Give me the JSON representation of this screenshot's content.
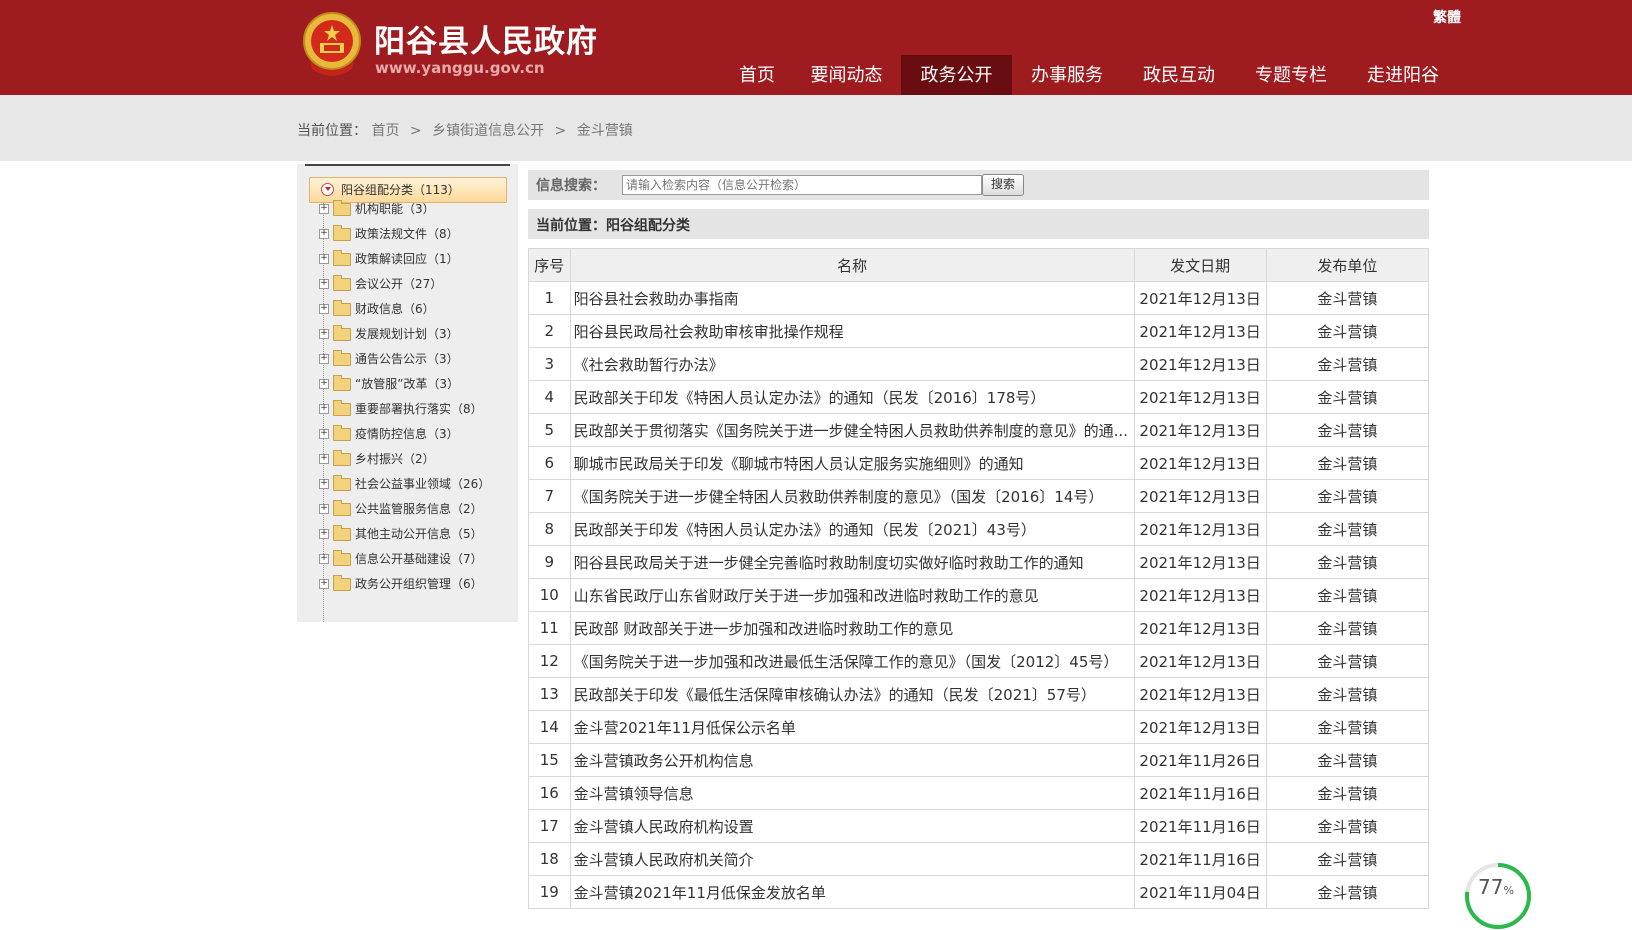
{
  "header": {
    "title": "阳谷县人民政府",
    "domain": "www.yanggu.gov.cn",
    "lang_switch": "繁體",
    "nav": [
      {
        "label": "首页",
        "active": false
      },
      {
        "label": "要闻动态",
        "active": false
      },
      {
        "label": "政务公开",
        "active": true
      },
      {
        "label": "办事服务",
        "active": false
      },
      {
        "label": "政民互动",
        "active": false
      },
      {
        "label": "专题专栏",
        "active": false
      },
      {
        "label": "走进阳谷",
        "active": false
      }
    ]
  },
  "breadcrumb": {
    "prefix": "当前位置：",
    "items": [
      "首页",
      "乡镇街道信息公开",
      "金斗营镇"
    ],
    "separator": ">"
  },
  "sidebar": {
    "root": "阳谷组配分类（113）",
    "items": [
      "机构职能（3）",
      "政策法规文件（8）",
      "政策解读回应（1）",
      "会议公开（27）",
      "财政信息（6）",
      "发展规划计划（3）",
      "通告公告公示（3）",
      "“放管服”改革（3）",
      "重要部署执行落实（8）",
      "疫情防控信息（3）",
      "乡村振兴（2）",
      "社会公益事业领域（26）",
      "公共监管服务信息（2）",
      "其他主动公开信息（5）",
      "信息公开基础建设（7）",
      "政务公开组织管理（6）"
    ]
  },
  "search": {
    "label": "信息搜索：",
    "placeholder": "请输入检索内容（信息公开检索）",
    "button": "搜索"
  },
  "position": {
    "label": "当前位置：阳谷组配分类"
  },
  "table": {
    "headers": [
      "序号",
      "名称",
      "发文日期",
      "发布单位"
    ],
    "rows": [
      {
        "no": "1",
        "title": "阳谷县社会救助办事指南",
        "date": "2021年12月13日",
        "unit": "金斗营镇"
      },
      {
        "no": "2",
        "title": "阳谷县民政局社会救助审核审批操作规程",
        "date": "2021年12月13日",
        "unit": "金斗营镇"
      },
      {
        "no": "3",
        "title": "《社会救助暂行办法》",
        "date": "2021年12月13日",
        "unit": "金斗营镇"
      },
      {
        "no": "4",
        "title": "民政部关于印发《特困人员认定办法》的通知（民发〔2016〕178号）",
        "date": "2021年12月13日",
        "unit": "金斗营镇"
      },
      {
        "no": "5",
        "title": "民政部关于贯彻落实《国务院关于进一步健全特困人员救助供养制度的意见》的通...",
        "date": "2021年12月13日",
        "unit": "金斗营镇"
      },
      {
        "no": "6",
        "title": "聊城市民政局关于印发《聊城市特困人员认定服务实施细则》的通知",
        "date": "2021年12月13日",
        "unit": "金斗营镇"
      },
      {
        "no": "7",
        "title": "《国务院关于进一步健全特困人员救助供养制度的意见》（国发〔2016〕14号）",
        "date": "2021年12月13日",
        "unit": "金斗营镇"
      },
      {
        "no": "8",
        "title": "民政部关于印发《特困人员认定办法》的通知（民发〔2021〕43号）",
        "date": "2021年12月13日",
        "unit": "金斗营镇"
      },
      {
        "no": "9",
        "title": "阳谷县民政局关于进一步健全完善临时救助制度切实做好临时救助工作的通知",
        "date": "2021年12月13日",
        "unit": "金斗营镇"
      },
      {
        "no": "10",
        "title": "山东省民政厅山东省财政厅关于进一步加强和改进临时救助工作的意见",
        "date": "2021年12月13日",
        "unit": "金斗营镇"
      },
      {
        "no": "11",
        "title": "民政部 财政部关于进一步加强和改进临时救助工作的意见",
        "date": "2021年12月13日",
        "unit": "金斗营镇"
      },
      {
        "no": "12",
        "title": "《国务院关于进一步加强和改进最低生活保障工作的意见》（国发〔2012〕45号）",
        "date": "2021年12月13日",
        "unit": "金斗营镇"
      },
      {
        "no": "13",
        "title": "民政部关于印发《最低生活保障审核确认办法》的通知（民发〔2021〕57号）",
        "date": "2021年12月13日",
        "unit": "金斗营镇"
      },
      {
        "no": "14",
        "title": "金斗营2021年11月低保公示名单",
        "date": "2021年12月13日",
        "unit": "金斗营镇"
      },
      {
        "no": "15",
        "title": "金斗营镇政务公开机构信息",
        "date": "2021年11月26日",
        "unit": "金斗营镇"
      },
      {
        "no": "16",
        "title": "金斗营镇领导信息",
        "date": "2021年11月16日",
        "unit": "金斗营镇"
      },
      {
        "no": "17",
        "title": "金斗营镇人民政府机构设置",
        "date": "2021年11月16日",
        "unit": "金斗营镇"
      },
      {
        "no": "18",
        "title": "金斗营镇人民政府机关简介",
        "date": "2021年11月16日",
        "unit": "金斗营镇"
      },
      {
        "no": "19",
        "title": "金斗营镇2021年11月低保金发放名单",
        "date": "2021年11月04日",
        "unit": "金斗营镇"
      }
    ]
  },
  "progress": {
    "value": "77",
    "unit": "%",
    "fraction": 0.77,
    "color": "#2db84d"
  },
  "colors": {
    "header_bg": "#9e1c20",
    "nav_active_bg": "#6a0d10"
  }
}
